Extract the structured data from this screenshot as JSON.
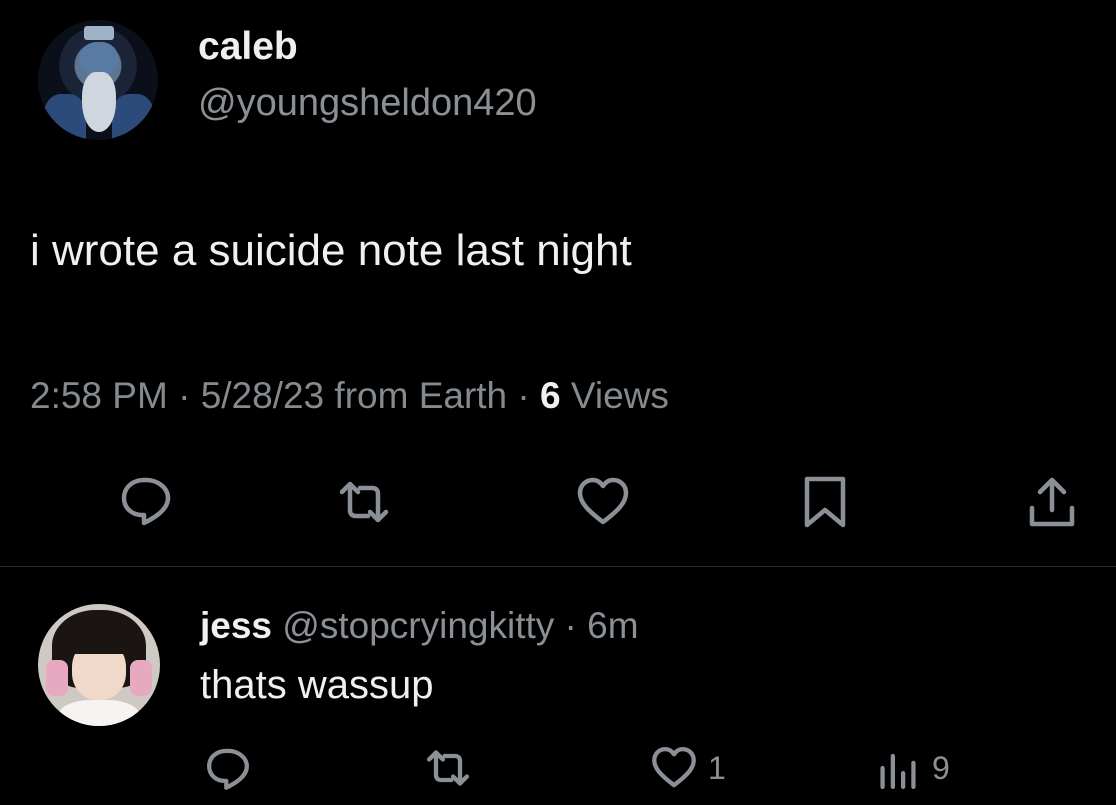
{
  "main_tweet": {
    "author_name": "caleb",
    "author_handle": "@youngsheldon420",
    "text": "i wrote a suicide note last night",
    "time": "2:58 PM",
    "sep1": " · ",
    "date": "5/28/23",
    "source": " from Earth",
    "sep2": " · ",
    "views_count": "6",
    "views_label": " Views",
    "actions": [
      "reply-icon",
      "retweet-icon",
      "like-icon",
      "bookmark-icon",
      "share-icon"
    ]
  },
  "reply": {
    "author_name": "jess",
    "author_handle": " @stopcryingkitty",
    "separator": " · ",
    "age": "6m",
    "text": "thats wassup",
    "likes": "1",
    "views": "9",
    "actions": [
      "reply-icon",
      "retweet-icon",
      "like-icon",
      "views-icon"
    ]
  },
  "colors": {
    "background": "#000000",
    "text_primary": "#eef0f1",
    "text_secondary": "#8b9096",
    "divider": "#2a2d31"
  }
}
